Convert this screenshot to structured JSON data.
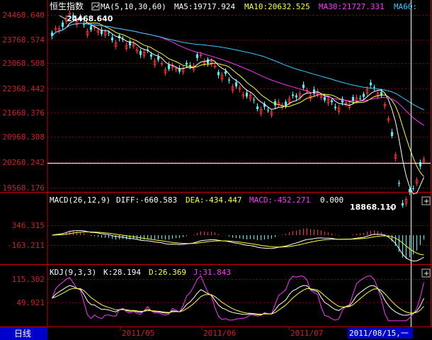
{
  "main": {
    "title": "恒生指数",
    "indicator": "MA(5,10,30,60)",
    "ma5": "MA5:19717.924",
    "ma10": "MA10:20632.525",
    "ma30": "MA30:21727.331",
    "ma60": "MA60:",
    "y_labels": [
      "24468.640",
      "23768.574",
      "23068.508",
      "22368.442",
      "21668.376",
      "20968.308",
      "20268.242",
      "19568.176"
    ],
    "high_label": "24468.640",
    "low_label": "18868.110"
  },
  "macd": {
    "indicator": "MACD(26,12,9)",
    "diff": "DIFF:-660.583",
    "dea": "DEA:-434.447",
    "macd": "MACD:-452.271",
    "extra": "0.000",
    "y_labels": [
      "346.315",
      "-163.211"
    ]
  },
  "kdj": {
    "indicator": "KDJ(9,3,3)",
    "k": "K:28.194",
    "d": "D:26.369",
    "j": "J:31.843",
    "y_labels": [
      "115.302",
      "49.921"
    ]
  },
  "footer": {
    "period_tab": "日线",
    "dates": [
      "2011/05",
      "2011/06",
      "2011/07"
    ],
    "cursor_date": "2011/08/15,一"
  },
  "colors": {
    "up": "#ff3333",
    "down": "#33ffff",
    "ma5": "#ffffff",
    "ma10": "#ffff33",
    "ma30": "#ff33ff",
    "ma60": "#33ccff",
    "axis": "#cc0000",
    "label": "#cc2222"
  },
  "chart_data": {
    "type": "candlestick",
    "ylim": [
      18868.11,
      24468.64
    ],
    "highest": 24468.64,
    "lowest": 18868.11,
    "macd_range": [
      -163.211,
      346.315
    ],
    "kdj_range": [
      49.921,
      115.302
    ]
  }
}
